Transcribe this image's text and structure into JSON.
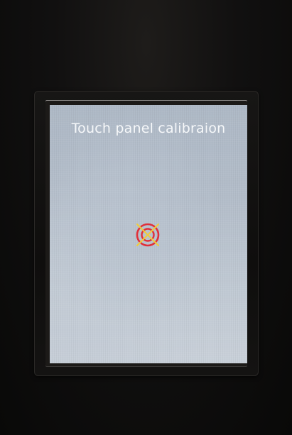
{
  "screen": {
    "title": "Touch panel calibraion"
  },
  "calibration_target": {
    "icon": "crosshair-target-icon",
    "ring_color": "#e0303a",
    "cross_color": "#f2cc3a"
  }
}
